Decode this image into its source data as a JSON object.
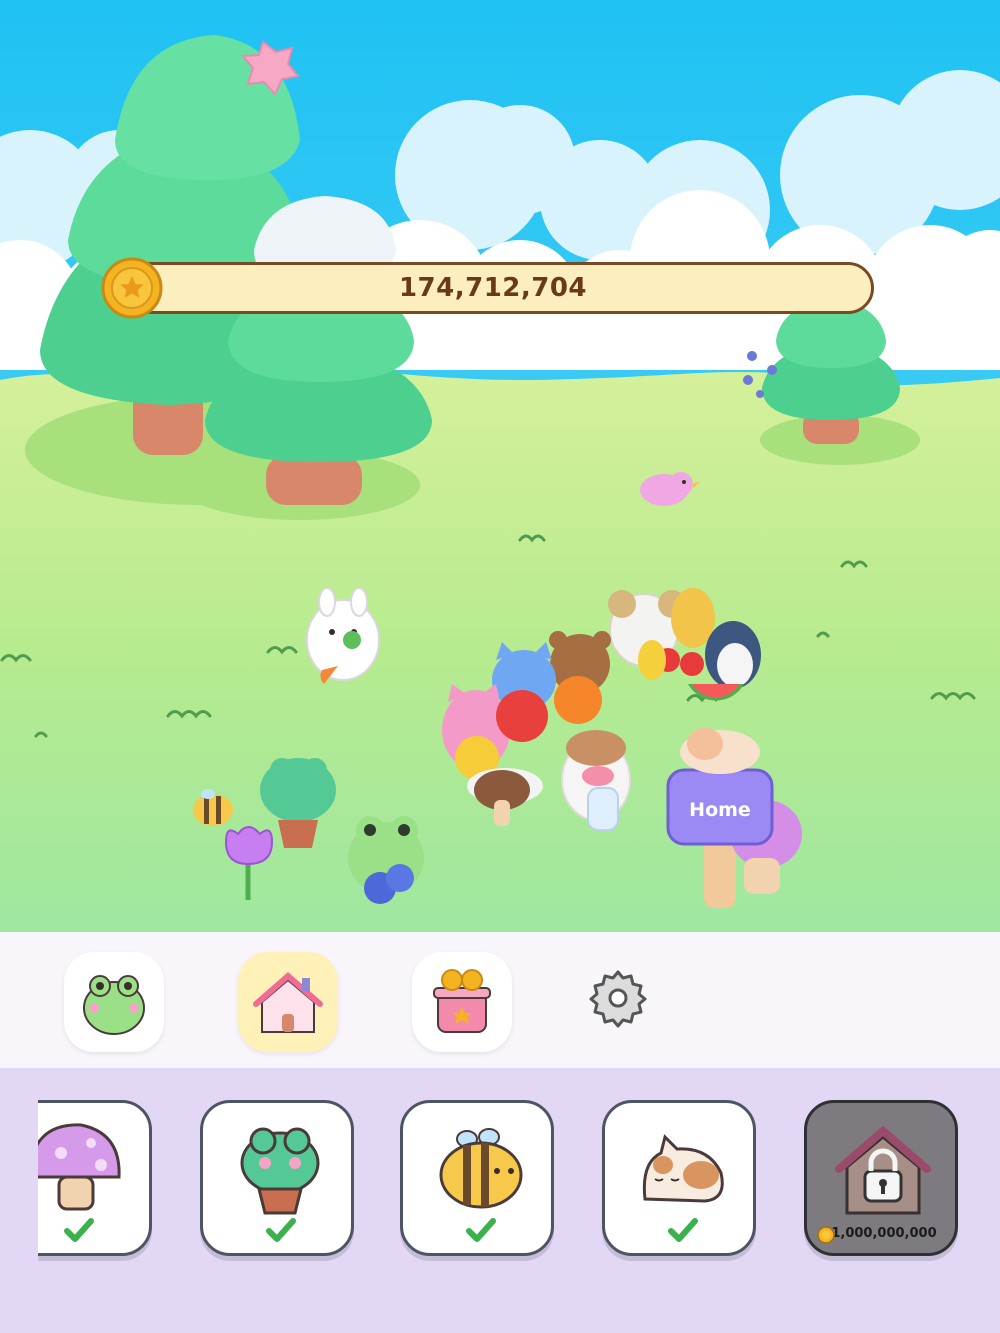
{
  "hud": {
    "coins": "174,712,704"
  },
  "scene": {
    "home_sign": "Home"
  },
  "tabs": [
    {
      "id": "frogs",
      "active": false
    },
    {
      "id": "home",
      "active": true
    },
    {
      "id": "shop",
      "active": false
    },
    {
      "id": "settings",
      "active": false
    }
  ],
  "shelf": {
    "items": [
      {
        "id": "mushroom",
        "owned": true
      },
      {
        "id": "frog-pot",
        "owned": true
      },
      {
        "id": "bee",
        "owned": true
      },
      {
        "id": "cat",
        "owned": true
      },
      {
        "id": "house",
        "owned": false,
        "price": "1,000,000,000"
      }
    ]
  },
  "colors": {
    "sky": "#2ec9f4",
    "grass": "#b9ec8e",
    "accent": "#fff1b8",
    "shelf_bg": "#e2d8f6",
    "coin_bar": "#fdeec0"
  }
}
